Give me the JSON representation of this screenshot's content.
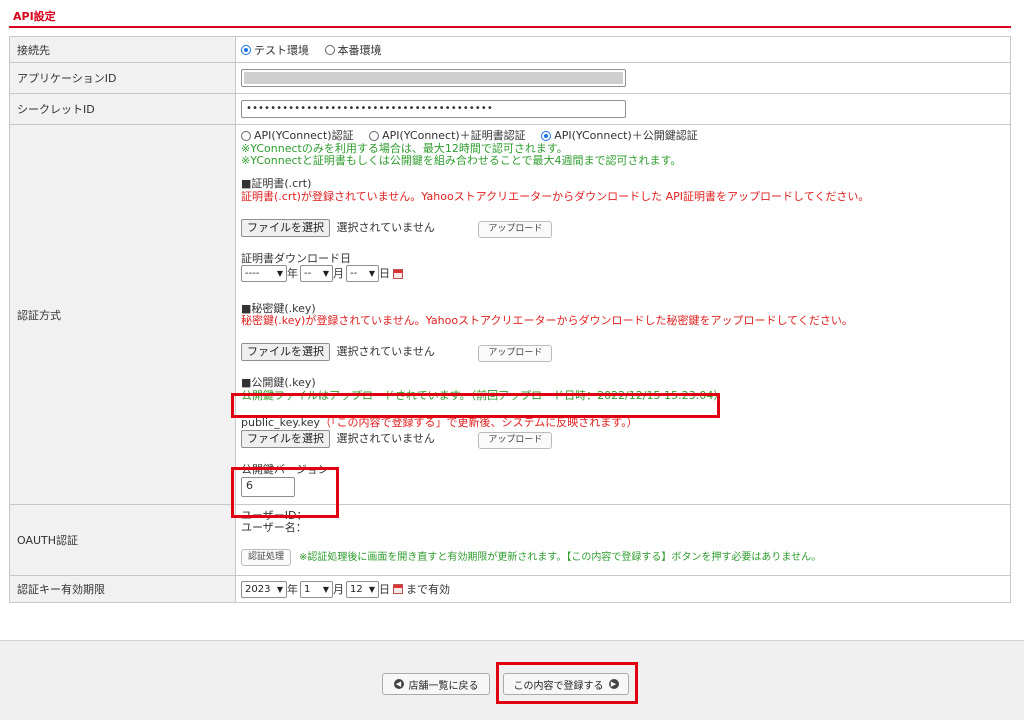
{
  "section_title": "API設定",
  "rows": {
    "connection": {
      "label": "接続先",
      "options": [
        "テスト環境",
        "本番環境"
      ],
      "selected": "テスト環境"
    },
    "app_id": {
      "label": "アプリケーションID"
    },
    "secret_id": {
      "label": "シークレットID",
      "value": "•••••••••••••••••••••••••••••••••••••••••"
    },
    "auth_method": {
      "label": "認証方式",
      "options": [
        "API(YConnect)認証",
        "API(YConnect)＋証明書認証",
        "API(YConnect)＋公開鍵認証"
      ],
      "selected": "API(YConnect)＋公開鍵認証",
      "note1": "※YConnectのみを利用する場合は、最大12時間で認可されます。",
      "note2": "※YConnectと証明書もしくは公開鍵を組み合わせることで最大4週間まで認可されます。",
      "cert_heading": "■証明書(.crt)",
      "cert_warning": "証明書(.crt)が登録されていません。Yahooストアクリエーターからダウンロードした API証明書をアップロードしてください。",
      "file_button": "ファイルを選択",
      "no_file": "選択されていません",
      "upload_button": "アップロード",
      "cert_download_label": "証明書ダウンロード日",
      "date_year": "----",
      "date_month": "--",
      "date_day": "--",
      "year_unit": "年",
      "month_unit": "月",
      "day_unit": "日",
      "secret_key_heading": "■秘密鍵(.key)",
      "secret_key_warning": "秘密鍵(.key)が登録されていません。Yahooストアクリエーターからダウンロードした秘密鍵をアップロードしてください。",
      "public_key_heading": "■公開鍵(.key)",
      "public_key_status": "公開鍵ファイルはアップロードされています。（前回アップロード日時：2022/12/15 15:23:04）",
      "public_key_file": "public_key.key",
      "public_key_note": "（「この内容で登録する」で更新後、システムに反映されます。）",
      "public_key_version_label": "公開鍵バージョン",
      "public_key_version": "6"
    },
    "oauth": {
      "label": "OAUTH認証",
      "user_id_label": "ユーザーID：",
      "user_name_label": "ユーザー名：",
      "auth_button": "認証処理",
      "note": "※認証処理後に画面を開き直すと有効期限が更新されます。【この内容で登録する】ボタンを押す必要はありません。"
    },
    "expiry": {
      "label": "認証キー有効期限",
      "year": "2023",
      "month": "1",
      "day": "12",
      "suffix": "まで有効"
    }
  },
  "footer": {
    "back_button": "店舗一覧に戻る",
    "submit_button": "この内容で登録する"
  },
  "colors": {
    "accent": "#d9001b",
    "note_green": "#2e9d2e",
    "warning_red": "#e02020",
    "highlight_box": "#e00012"
  }
}
